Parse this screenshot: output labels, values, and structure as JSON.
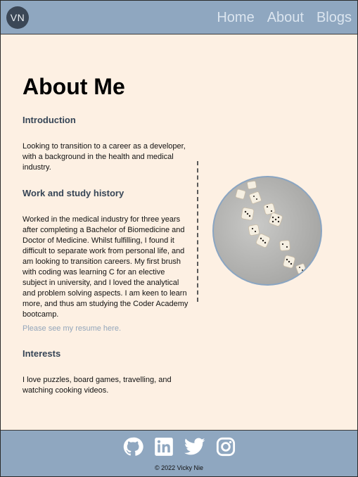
{
  "header": {
    "logo_text": "VN",
    "nav": [
      "Home",
      "About",
      "Blogs"
    ]
  },
  "main": {
    "title": "About Me",
    "sections": [
      {
        "heading": "Introduction",
        "text": "Looking to transition to a career as a developer, with a background in the health and medical industry."
      },
      {
        "heading": "Work and study history",
        "text": "Worked in the medical industry for three years after completing a Bachelor of Biomedicine and Doctor of Medicine. Whilst fulfilling, I found it difficult to separate work from personal life, and am looking to transition careers. My first brush with coding was learning C for an elective subject in university, and I loved the analytical and problem solving aspects. I am keen to learn more, and thus am studying the Coder Academy bootcamp."
      },
      {
        "heading": "Interests",
        "text": "I love puzzles, board games, travelling, and watching cooking videos."
      }
    ],
    "resume_link": "Please see my resume here."
  },
  "footer": {
    "social_icons": [
      "github-icon",
      "linkedin-icon",
      "twitter-icon",
      "instagram-icon"
    ],
    "copyright": "© 2022 Vicky Nie"
  },
  "colors": {
    "header_bg": "#8fa7c0",
    "page_bg": "#fdf0e3",
    "logo_bg": "#3b4756",
    "link": "#93a6bb"
  }
}
